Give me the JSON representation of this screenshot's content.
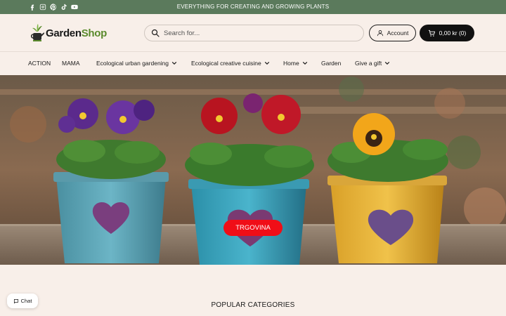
{
  "announcement": {
    "text": "EVERYTHING FOR CREATING AND GROWING PLANTS",
    "socials": [
      "facebook-icon",
      "instagram-icon",
      "pinterest-icon",
      "tiktok-icon",
      "youtube-icon"
    ]
  },
  "header": {
    "logo_part1": "Garden",
    "logo_part2": "Shop",
    "search_placeholder": "Search for...",
    "account_label": "Account",
    "cart_label": "0,00 kr (0)"
  },
  "nav": {
    "items": [
      {
        "label": "ACTION",
        "has_dropdown": false
      },
      {
        "label": "MAMA",
        "has_dropdown": false
      },
      {
        "label": "Ecological urban gardening",
        "has_dropdown": true
      },
      {
        "label": "Ecological creative cuisine",
        "has_dropdown": true
      },
      {
        "label": "Home",
        "has_dropdown": true
      },
      {
        "label": "Garden",
        "has_dropdown": false
      },
      {
        "label": "Give a gift",
        "has_dropdown": true
      }
    ]
  },
  "hero": {
    "cta_label": "TRGOVINA"
  },
  "sections": {
    "popular_title": "POPULAR CATEGORIES"
  },
  "chat": {
    "label": "Chat"
  },
  "colors": {
    "topbar": "#5b7a5c",
    "background": "#f8efe9",
    "cta": "#f00e17",
    "cart": "#111111",
    "logo_accent": "#5a8a2c"
  }
}
